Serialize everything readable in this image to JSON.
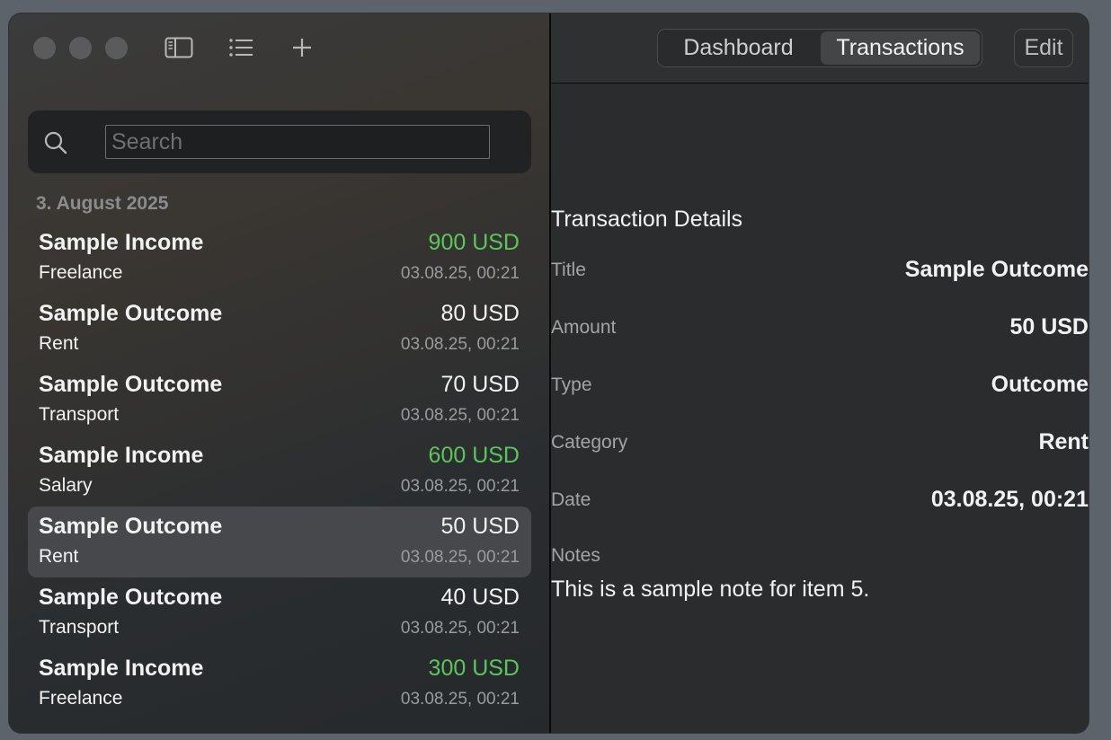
{
  "sidebar": {
    "search": {
      "placeholder": "Search",
      "value": ""
    },
    "section_header": "3. August 2025",
    "transactions": [
      {
        "title": "Sample Income",
        "category": "Freelance",
        "amount": "900 USD",
        "date": "03.08.25, 00:21",
        "type": "income"
      },
      {
        "title": "Sample Outcome",
        "category": "Rent",
        "amount": "80 USD",
        "date": "03.08.25, 00:21",
        "type": "outcome"
      },
      {
        "title": "Sample Outcome",
        "category": "Transport",
        "amount": "70 USD",
        "date": "03.08.25, 00:21",
        "type": "outcome"
      },
      {
        "title": "Sample Income",
        "category": "Salary",
        "amount": "600 USD",
        "date": "03.08.25, 00:21",
        "type": "income"
      },
      {
        "title": "Sample Outcome",
        "category": "Rent",
        "amount": "50 USD",
        "date": "03.08.25, 00:21",
        "type": "outcome",
        "selected": true
      },
      {
        "title": "Sample Outcome",
        "category": "Transport",
        "amount": "40 USD",
        "date": "03.08.25, 00:21",
        "type": "outcome"
      },
      {
        "title": "Sample Income",
        "category": "Freelance",
        "amount": "300 USD",
        "date": "03.08.25, 00:21",
        "type": "income"
      }
    ]
  },
  "toolbar": {
    "icons": [
      "sidebar-toggle-icon",
      "list-icon",
      "plus-icon"
    ],
    "tabs": [
      {
        "label": "Dashboard",
        "active": false
      },
      {
        "label": "Transactions",
        "active": true
      }
    ],
    "edit_label": "Edit"
  },
  "detail": {
    "heading": "Transaction Details",
    "fields": {
      "title": {
        "label": "Title",
        "value": "Sample Outcome"
      },
      "amount": {
        "label": "Amount",
        "value": "50 USD"
      },
      "type": {
        "label": "Type",
        "value": "Outcome"
      },
      "category": {
        "label": "Category",
        "value": "Rent"
      },
      "date": {
        "label": "Date",
        "value": "03.08.25, 00:21"
      }
    },
    "notes_label": "Notes",
    "notes": "This is a sample note for item 5."
  },
  "colors": {
    "income": "#5bc75a",
    "selection": "#46484b",
    "window_bg": "#2b2c2e"
  }
}
